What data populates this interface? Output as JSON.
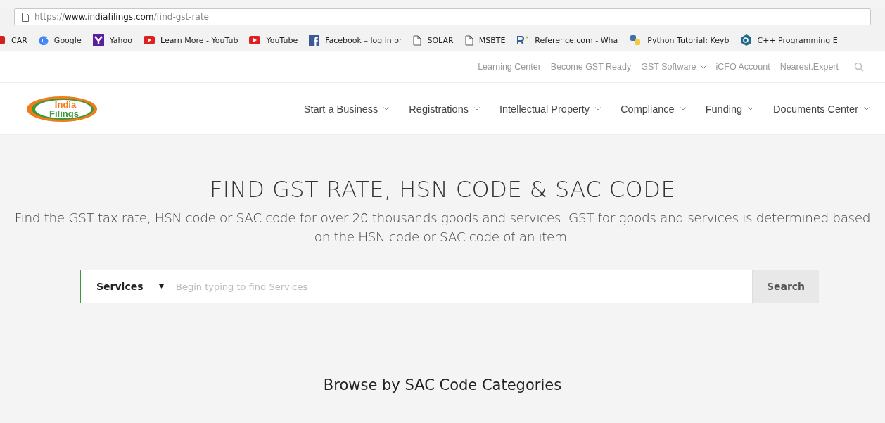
{
  "browser": {
    "url_scheme": "https://",
    "url_host": "www.indiafilings.com",
    "url_path": "/find-gst-rate",
    "bookmarks": [
      {
        "kind": "red",
        "label": "CAR"
      },
      {
        "kind": "google",
        "label": "Google"
      },
      {
        "kind": "yahoo",
        "label": "Yahoo"
      },
      {
        "kind": "youtube",
        "label": "Learn More - YouTub"
      },
      {
        "kind": "youtube",
        "label": "YouTube"
      },
      {
        "kind": "facebook",
        "label": "Facebook – log in or"
      },
      {
        "kind": "page",
        "label": "SOLAR"
      },
      {
        "kind": "page",
        "label": "MSBTE"
      },
      {
        "kind": "reference",
        "label": "Reference.com - Wha"
      },
      {
        "kind": "python",
        "label": "Python Tutorial: Keyb"
      },
      {
        "kind": "cpp",
        "label": "C++ Programming E"
      }
    ]
  },
  "top_links": [
    {
      "label": "Learning Center",
      "dropdown": false
    },
    {
      "label": "Become GST Ready",
      "dropdown": false
    },
    {
      "label": "GST Software",
      "dropdown": true
    },
    {
      "label": "iCFO Account",
      "dropdown": false
    },
    {
      "label": "Nearest.Expert",
      "dropdown": false
    }
  ],
  "logo": {
    "line_1": "India",
    "line_2": "Filings"
  },
  "nav": [
    {
      "label": "Start a Business"
    },
    {
      "label": "Registrations"
    },
    {
      "label": "Intellectual Property"
    },
    {
      "label": "Compliance"
    },
    {
      "label": "Funding"
    },
    {
      "label": "Documents Center"
    }
  ],
  "hero": {
    "title": "FIND GST RATE, HSN CODE & SAC CODE",
    "subtitle": "Find the GST tax rate, HSN code or SAC code for over 20 thousands goods and services. GST for goods and services is determined based on the HSN code or SAC code of an item.",
    "category_select": {
      "value": "Services"
    },
    "search_field": {
      "placeholder": "Begin typing to find Services"
    },
    "search_button": "Search"
  },
  "browse_heading": "Browse by SAC Code Categories"
}
